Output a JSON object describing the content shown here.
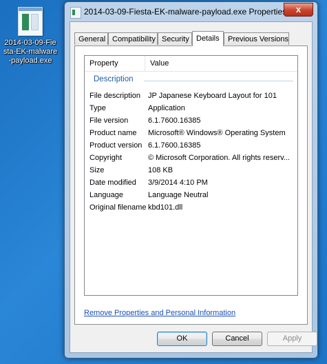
{
  "desktop": {
    "icon_label": "2014-03-09-Fiesta-EK-malware-payload.exe"
  },
  "window": {
    "title": "2014-03-09-Fiesta-EK-malware-payload.exe Properties",
    "close_glyph": "x"
  },
  "tabs": [
    {
      "label": "General"
    },
    {
      "label": "Compatibility"
    },
    {
      "label": "Security"
    },
    {
      "label": "Details"
    },
    {
      "label": "Previous Versions"
    }
  ],
  "active_tab": "Details",
  "list": {
    "columns": {
      "property": "Property",
      "value": "Value"
    },
    "group": "Description",
    "rows": [
      {
        "property": "File description",
        "value": "JP Japanese Keyboard Layout for 101"
      },
      {
        "property": "Type",
        "value": "Application"
      },
      {
        "property": "File version",
        "value": "6.1.7600.16385"
      },
      {
        "property": "Product name",
        "value": "Microsoft® Windows® Operating System"
      },
      {
        "property": "Product version",
        "value": "6.1.7600.16385"
      },
      {
        "property": "Copyright",
        "value": "© Microsoft Corporation. All rights reserv..."
      },
      {
        "property": "Size",
        "value": "108 KB"
      },
      {
        "property": "Date modified",
        "value": "3/9/2014 4:10 PM"
      },
      {
        "property": "Language",
        "value": "Language Neutral"
      },
      {
        "property": "Original filename",
        "value": "kbd101.dll"
      }
    ]
  },
  "link": "Remove Properties and Personal Information",
  "buttons": {
    "ok": "OK",
    "cancel": "Cancel",
    "apply": "Apply"
  },
  "colors": {
    "desktop": "#2a86d6",
    "link": "#1a4fb4",
    "group_heading": "#1e5aa8",
    "close_button": "#c8442b"
  }
}
